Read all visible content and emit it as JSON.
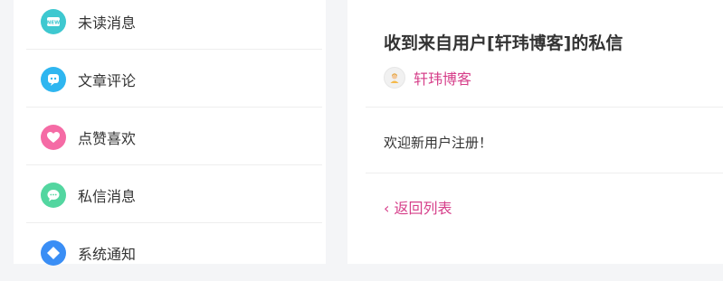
{
  "sidebar": {
    "items": [
      {
        "label": "未读消息",
        "icon": "new-message-icon",
        "color": "#3ec8d0"
      },
      {
        "label": "文章评论",
        "icon": "comment-icon",
        "color": "#2fb6f0"
      },
      {
        "label": "点赞喜欢",
        "icon": "heart-icon",
        "color": "#f56ba5"
      },
      {
        "label": "私信消息",
        "icon": "chat-icon",
        "color": "#53d6a0"
      },
      {
        "label": "系统通知",
        "icon": "notification-icon",
        "color": "#3a8ef5"
      }
    ]
  },
  "message": {
    "title": "收到来自用户[轩玮博客]的私信",
    "sender": "轩玮博客",
    "body": "欢迎新用户注册！",
    "back_label": "‹ 返回列表"
  },
  "colors": {
    "accent": "#d63f8a",
    "text": "#333333",
    "page_bg": "#f4f5f7"
  }
}
